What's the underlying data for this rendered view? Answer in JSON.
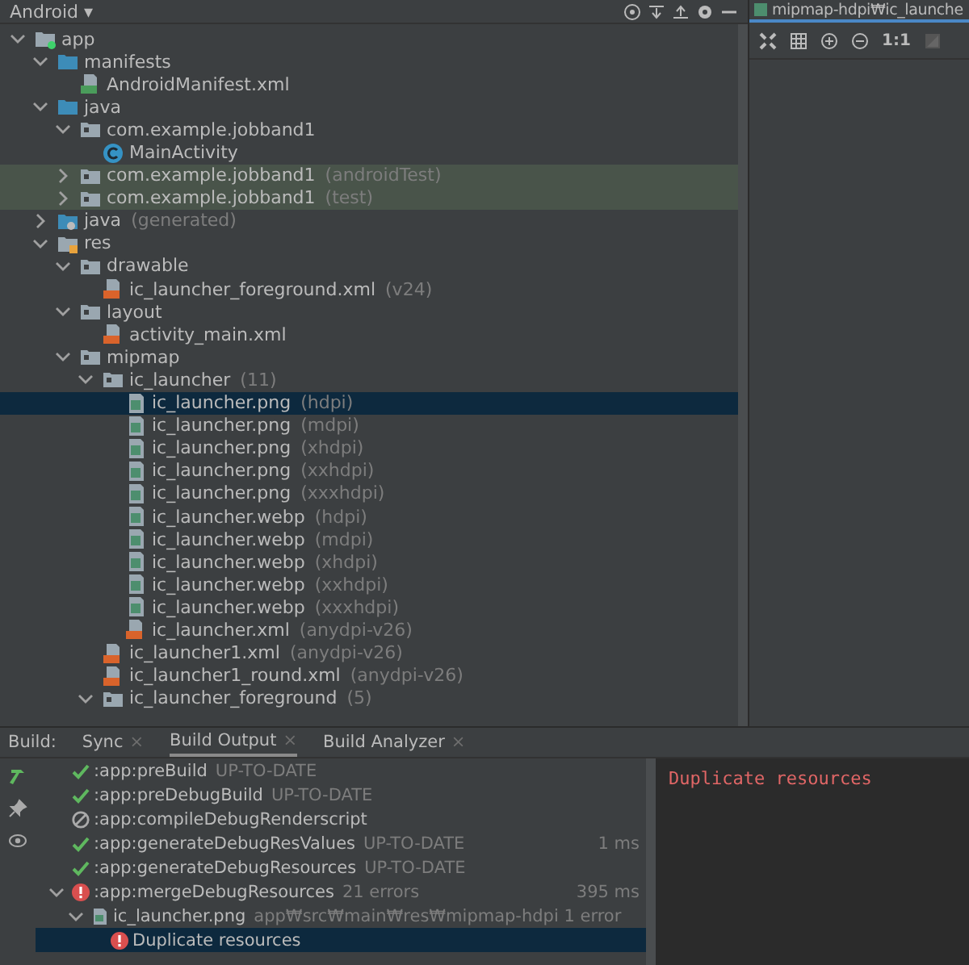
{
  "project": {
    "view": "Android",
    "view_caret": "▾",
    "tree": [
      {
        "kind": "module",
        "name": "app",
        "expanded": true,
        "selected": false,
        "children": [
          {
            "kind": "source-folder",
            "name": "manifests",
            "expanded": true,
            "selected": false,
            "children": [
              {
                "kind": "manifest-file",
                "name": "AndroidManifest.xml",
                "selected": false
              }
            ]
          },
          {
            "kind": "source-folder",
            "name": "java",
            "expanded": true,
            "selected": false,
            "children": [
              {
                "kind": "package",
                "name": "com.example.jobband1",
                "expanded": true,
                "selected": false,
                "children": [
                  {
                    "kind": "class",
                    "name": "MainActivity",
                    "selected": false
                  }
                ]
              },
              {
                "kind": "test-package",
                "name": "com.example.jobband1",
                "qualifier": "(androidTest)",
                "expanded": false,
                "selected": false
              },
              {
                "kind": "test-package",
                "name": "com.example.jobband1",
                "qualifier": "(test)",
                "expanded": false,
                "selected": false
              }
            ]
          },
          {
            "kind": "generated-folder",
            "name": "java",
            "qualifier": "(generated)",
            "expanded": false,
            "selected": false
          },
          {
            "kind": "resource-folder",
            "name": "res",
            "expanded": true,
            "selected": false,
            "children": [
              {
                "kind": "folder",
                "name": "drawable",
                "expanded": true,
                "selected": false,
                "children": [
                  {
                    "kind": "xml-file",
                    "name": "ic_launcher_foreground.xml",
                    "qualifier": "(v24)",
                    "selected": false
                  }
                ]
              },
              {
                "kind": "folder",
                "name": "layout",
                "expanded": true,
                "selected": false,
                "children": [
                  {
                    "kind": "xml-file",
                    "name": "activity_main.xml",
                    "selected": false
                  }
                ]
              },
              {
                "kind": "folder",
                "name": "mipmap",
                "expanded": true,
                "selected": false,
                "children": [
                  {
                    "kind": "folder",
                    "name": "ic_launcher",
                    "qualifier": "(11)",
                    "expanded": true,
                    "selected": false,
                    "children": [
                      {
                        "kind": "image-file",
                        "name": "ic_launcher.png",
                        "qualifier": "(hdpi)",
                        "selected": true
                      },
                      {
                        "kind": "image-file",
                        "name": "ic_launcher.png",
                        "qualifier": "(mdpi)",
                        "selected": false
                      },
                      {
                        "kind": "image-file",
                        "name": "ic_launcher.png",
                        "qualifier": "(xhdpi)",
                        "selected": false
                      },
                      {
                        "kind": "image-file",
                        "name": "ic_launcher.png",
                        "qualifier": "(xxhdpi)",
                        "selected": false
                      },
                      {
                        "kind": "image-file",
                        "name": "ic_launcher.png",
                        "qualifier": "(xxxhdpi)",
                        "selected": false
                      },
                      {
                        "kind": "image-file",
                        "name": "ic_launcher.webp",
                        "qualifier": "(hdpi)",
                        "selected": false
                      },
                      {
                        "kind": "image-file",
                        "name": "ic_launcher.webp",
                        "qualifier": "(mdpi)",
                        "selected": false
                      },
                      {
                        "kind": "image-file",
                        "name": "ic_launcher.webp",
                        "qualifier": "(xhdpi)",
                        "selected": false
                      },
                      {
                        "kind": "image-file",
                        "name": "ic_launcher.webp",
                        "qualifier": "(xxhdpi)",
                        "selected": false
                      },
                      {
                        "kind": "image-file",
                        "name": "ic_launcher.webp",
                        "qualifier": "(xxxhdpi)",
                        "selected": false
                      },
                      {
                        "kind": "xml-file",
                        "name": "ic_launcher.xml",
                        "qualifier": "(anydpi-v26)",
                        "selected": false
                      }
                    ]
                  },
                  {
                    "kind": "xml-file",
                    "name": "ic_launcher1.xml",
                    "qualifier": "(anydpi-v26)",
                    "selected": false
                  },
                  {
                    "kind": "xml-file",
                    "name": "ic_launcher1_round.xml",
                    "qualifier": "(anydpi-v26)",
                    "selected": false
                  },
                  {
                    "kind": "folder",
                    "name": "ic_launcher_foreground",
                    "qualifier": "(5)",
                    "expanded": true,
                    "selected": false
                  }
                ]
              }
            ]
          }
        ]
      }
    ]
  },
  "image_editor": {
    "tab": "mipmap-hdpi₩ic_launche",
    "zoom_actual": "1:1"
  },
  "build": {
    "label": "Build:",
    "tabs": [
      {
        "label": "Sync",
        "close": "×",
        "selected": false
      },
      {
        "label": "Build Output",
        "close": "×",
        "selected": true
      },
      {
        "label": "Build Analyzer",
        "close": "×",
        "selected": false
      }
    ],
    "tasks": [
      {
        "kind": "success",
        "name": ":app:preBuild",
        "detail": "UP-TO-DATE",
        "selected": false
      },
      {
        "kind": "success",
        "name": ":app:preDebugBuild",
        "detail": "UP-TO-DATE",
        "selected": false
      },
      {
        "kind": "skipped",
        "name": ":app:compileDebugRenderscript",
        "selected": false
      },
      {
        "kind": "success",
        "name": ":app:generateDebugResValues",
        "detail": "UP-TO-DATE",
        "time": "1 ms",
        "selected": false
      },
      {
        "kind": "success",
        "name": ":app:generateDebugResources",
        "detail": "UP-TO-DATE",
        "selected": false
      },
      {
        "kind": "error",
        "name": ":app:mergeDebugResources",
        "detail": "21 errors",
        "time": "395 ms",
        "expanded": true,
        "selected": false,
        "children": [
          {
            "kind": "file",
            "name": "ic_launcher.png",
            "detail": "app₩src₩main₩res₩mipmap-hdpi 1 error",
            "expanded": true,
            "selected": false,
            "children": [
              {
                "kind": "error",
                "name": "Duplicate resources",
                "selected": true
              }
            ]
          }
        ]
      }
    ],
    "console": "Duplicate resources"
  }
}
